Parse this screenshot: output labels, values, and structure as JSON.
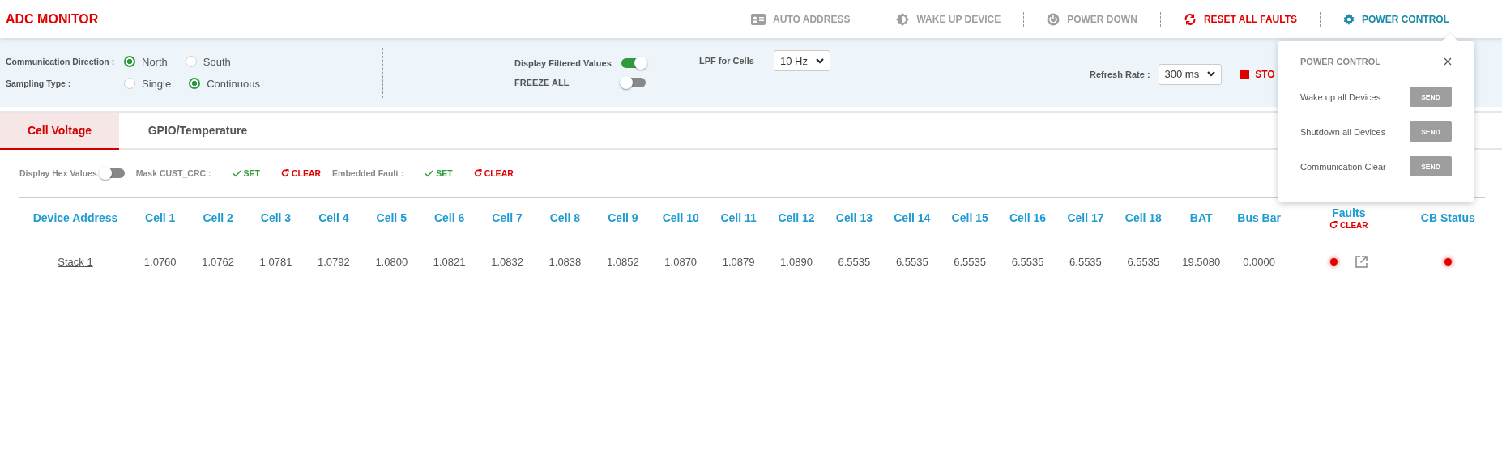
{
  "header": {
    "title": "ADC MONITOR",
    "actions": [
      {
        "label": "AUTO ADDRESS",
        "kind": "card",
        "color": "#9e9e9e"
      },
      {
        "label": "WAKE UP DEVICE",
        "kind": "chip",
        "color": "#9e9e9e"
      },
      {
        "label": "POWER DOWN",
        "kind": "power",
        "color": "#9e9e9e"
      },
      {
        "label": "RESET ALL FAULTS",
        "kind": "refresh",
        "color": "#e00000"
      },
      {
        "label": "POWER CONTROL",
        "kind": "gear",
        "color": "#1a8aa8"
      }
    ]
  },
  "controls": {
    "communication_direction": {
      "label": "Communication Direction :",
      "options": [
        {
          "label": "North",
          "selected": true
        },
        {
          "label": "South",
          "selected": false
        }
      ]
    },
    "sampling_type": {
      "label": "Sampling Type :",
      "options": [
        {
          "label": "Single",
          "selected": false
        },
        {
          "label": "Continuous",
          "selected": true
        }
      ]
    },
    "display_filtered_values": {
      "label": "Display Filtered Values",
      "on": true
    },
    "freeze_all": {
      "label": "FREEZE ALL",
      "on": false
    },
    "lpf_for_cells": {
      "label": "LPF for Cells",
      "value": "10 Hz"
    },
    "refresh_rate": {
      "label": "Refresh Rate :",
      "value": "300 ms"
    },
    "stop": {
      "label": "STO"
    }
  },
  "tabs": [
    {
      "label": "Cell Voltage",
      "selected": true
    },
    {
      "label": "GPIO/Temperature",
      "selected": false
    }
  ],
  "toolbar": {
    "display_hex_values": {
      "label": "Display Hex Values",
      "on": false
    },
    "masks": [
      {
        "label": "Mask CUST_CRC :",
        "set": "SET",
        "clear": "CLEAR"
      },
      {
        "label": "Embedded Fault :",
        "set": "SET",
        "clear": "CLEAR"
      }
    ]
  },
  "table": {
    "columns": [
      {
        "label": "Device Address"
      },
      {
        "label": "Cell 1"
      },
      {
        "label": "Cell 2"
      },
      {
        "label": "Cell 3"
      },
      {
        "label": "Cell 4"
      },
      {
        "label": "Cell 5"
      },
      {
        "label": "Cell 6"
      },
      {
        "label": "Cell 7"
      },
      {
        "label": "Cell 8"
      },
      {
        "label": "Cell 9"
      },
      {
        "label": "Cell 10"
      },
      {
        "label": "Cell 11"
      },
      {
        "label": "Cell 12"
      },
      {
        "label": "Cell 13"
      },
      {
        "label": "Cell 14"
      },
      {
        "label": "Cell 15"
      },
      {
        "label": "Cell 16"
      },
      {
        "label": "Cell 17"
      },
      {
        "label": "Cell 18"
      },
      {
        "label": "BAT"
      },
      {
        "label": "Bus Bar"
      },
      {
        "label": "Faults",
        "action": "CLEAR"
      },
      {
        "label": "CB Status"
      }
    ],
    "rows": [
      {
        "device": "Stack 1",
        "values": [
          "1.0760",
          "1.0762",
          "1.0781",
          "1.0792",
          "1.0800",
          "1.0821",
          "1.0832",
          "1.0838",
          "1.0852",
          "1.0870",
          "1.0879",
          "1.0890",
          "6.5535",
          "6.5535",
          "6.5535",
          "6.5535",
          "6.5535",
          "6.5535",
          "19.5080",
          "0.0000"
        ],
        "fault": true,
        "cb_status": true
      }
    ]
  },
  "popup": {
    "title": "POWER CONTROL",
    "items": [
      {
        "label": "Wake up all Devices",
        "button": "SEND"
      },
      {
        "label": "Shutdown all Devices",
        "button": "SEND"
      },
      {
        "label": "Communication Clear",
        "button": "SEND"
      }
    ]
  }
}
